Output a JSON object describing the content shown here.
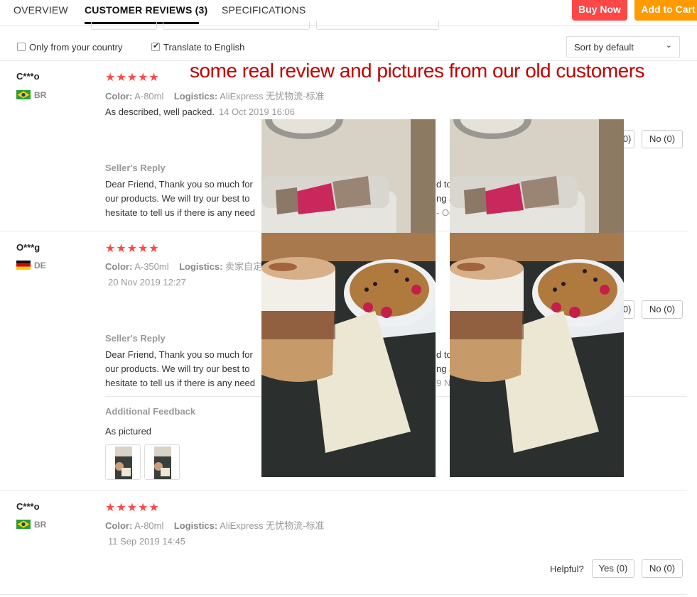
{
  "tabs": [
    {
      "label": "OVERVIEW"
    },
    {
      "label": "CUSTOMER REVIEWS (3)"
    },
    {
      "label": "SPECIFICATIONS"
    }
  ],
  "actions": {
    "buy_now": "Buy Now",
    "add_to_cart": "Add to Cart"
  },
  "filters": {
    "only_country": {
      "label": "Only from your country",
      "checked": false
    },
    "translate": {
      "label": "Translate to English",
      "checked": true
    },
    "sort": {
      "selected": "Sort by default"
    }
  },
  "promo_text": "some real review and pictures from our old customers",
  "reviews": [
    {
      "user": "C***o",
      "country": "BR",
      "rating": "★★★★★",
      "color_label": "Color:",
      "color_value": "A-80ml",
      "logistics_label": "Logistics:",
      "logistics_value": "AliExpress 无忧物流-标准",
      "feedback": "As described, well packed.",
      "date": "14 Oct 2019 16:06",
      "yes": "Yes (0)",
      "no": "No (0)",
      "seller_reply_title": "Seller's Reply",
      "reply_lines": [
        "Dear Friend, Thank you so much for",
        "our products. We will try our best to",
        "hesitate to tell us if there is any need"
      ],
      "reply_right": [
        "d to",
        "ng a",
        "- Oc"
      ]
    },
    {
      "user": "O***g",
      "country": "DE",
      "rating": "★★★★★",
      "color_label": "Color:",
      "color_value": "A-350ml",
      "logistics_label": "Logistics:",
      "logistics_value": "卖家自定义",
      "date": "20 Nov 2019 12:27",
      "yes": "Yes (0)",
      "no": "No (0)",
      "seller_reply_title": "Seller's Reply",
      "reply_lines": [
        "Dear Friend, Thank you so much for",
        "our products. We will try our best to",
        "hesitate to tell us if there is any need"
      ],
      "reply_right": [
        "d to",
        "ng a",
        "9 No"
      ],
      "additional_feedback_title": "Additional Feedback",
      "additional_feedback": "As pictured"
    },
    {
      "user": "C***o",
      "country": "BR",
      "rating": "★★★★★",
      "color_label": "Color:",
      "color_value": "A-80ml",
      "logistics_label": "Logistics:",
      "logistics_value": "AliExpress 无忧物流-标准",
      "date": "11 Sep 2019 14:45",
      "helpful_label": "Helpful?",
      "yes": "Yes (0)",
      "no": "No (0)"
    }
  ],
  "colors": {
    "accent_red": "#ff4747",
    "accent_orange": "#ff9a00",
    "promo_red": "#c00000"
  }
}
